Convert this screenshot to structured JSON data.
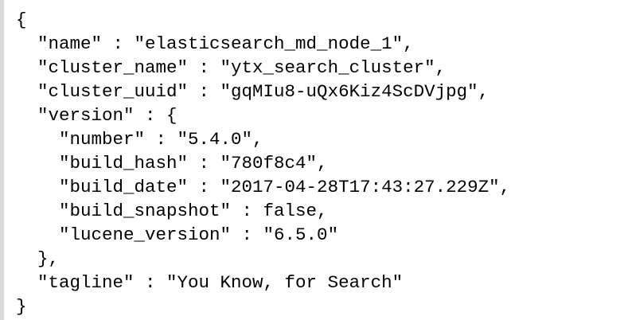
{
  "response": {
    "lines": [
      "{",
      "  \"name\" : \"elasticsearch_md_node_1\",",
      "  \"cluster_name\" : \"ytx_search_cluster\",",
      "  \"cluster_uuid\" : \"gqMIu8-uQx6Kiz4ScDVjpg\",",
      "  \"version\" : {",
      "    \"number\" : \"5.4.0\",",
      "    \"build_hash\" : \"780f8c4\",",
      "    \"build_date\" : \"2017-04-28T17:43:27.229Z\",",
      "    \"build_snapshot\" : false,",
      "    \"lucene_version\" : \"6.5.0\"",
      "  },",
      "  \"tagline\" : \"You Know, for Search\"",
      "}"
    ]
  },
  "colors": {
    "text": "#000000",
    "background": "#ffffff",
    "left_rule": "#d9d9d9"
  }
}
